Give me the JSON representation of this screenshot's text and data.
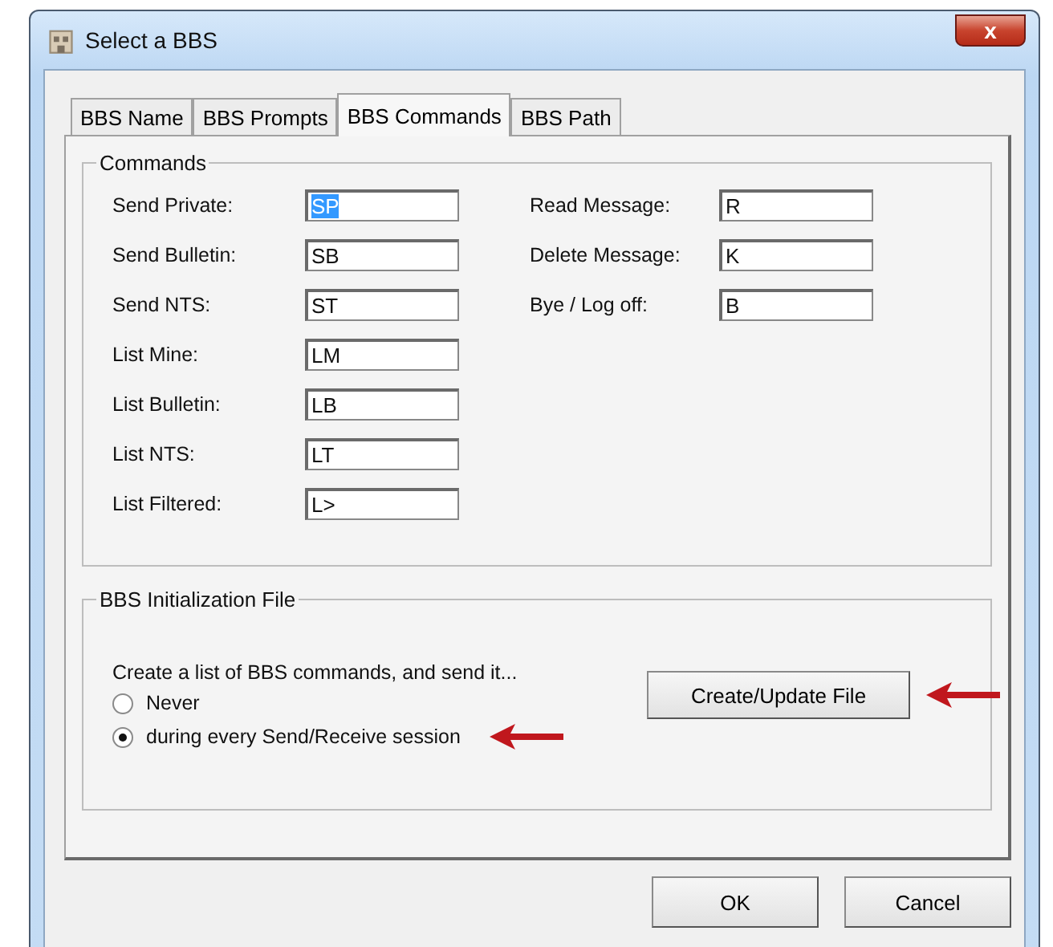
{
  "window": {
    "title": "Select a BBS",
    "close": "x"
  },
  "tabs": [
    {
      "label": "BBS Name",
      "selected": false
    },
    {
      "label": "BBS Prompts",
      "selected": false
    },
    {
      "label": "BBS Commands",
      "selected": true
    },
    {
      "label": "BBS Path",
      "selected": false
    }
  ],
  "commands": {
    "title": "Commands",
    "left": [
      {
        "label": "Send Private:",
        "value": "SP",
        "text_selected": true
      },
      {
        "label": "Send Bulletin:",
        "value": "SB",
        "text_selected": false
      },
      {
        "label": "Send NTS:",
        "value": "ST",
        "text_selected": false
      },
      {
        "label": "List Mine:",
        "value": "LM",
        "text_selected": false
      },
      {
        "label": "List Bulletin:",
        "value": "LB",
        "text_selected": false
      },
      {
        "label": "List NTS:",
        "value": "LT",
        "text_selected": false
      },
      {
        "label": "List Filtered:",
        "value": "L>",
        "text_selected": false
      }
    ],
    "right": [
      {
        "label": "Read Message:",
        "value": "R",
        "text_selected": false
      },
      {
        "label": "Delete Message:",
        "value": "K",
        "text_selected": false
      },
      {
        "label": "Bye / Log off:",
        "value": "B",
        "text_selected": false
      }
    ]
  },
  "init_file": {
    "title": "BBS Initialization File",
    "prompt": "Create a list of BBS commands, and send it...",
    "button": "Create/Update File",
    "options": [
      {
        "label": "Never",
        "selected": false
      },
      {
        "label": "during every Send/Receive session",
        "selected": true
      }
    ]
  },
  "buttons": [
    "OK",
    "Cancel"
  ]
}
